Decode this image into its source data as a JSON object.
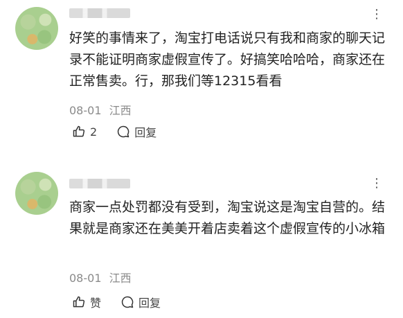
{
  "comments": [
    {
      "more_icon": "more-dots-icon",
      "text": "好笑的事情来了，淘宝打电话说只有我和商家的聊天记录不能证明商家虚假宣传了。好搞笑哈哈哈，商家还在正常售卖。行，那我们等12315看看",
      "date": "08-01",
      "location": "江西",
      "like_count": "2",
      "reply_label": "回复"
    },
    {
      "more_icon": "more-dots-icon",
      "text": "商家一点处罚都没有受到，淘宝说这是淘宝自营的。结果就是商家还在美美开着店卖着这个虚假宣传的小冰箱",
      "date": "08-01",
      "location": "江西",
      "like_label": "赞",
      "reply_label": "回复"
    }
  ]
}
